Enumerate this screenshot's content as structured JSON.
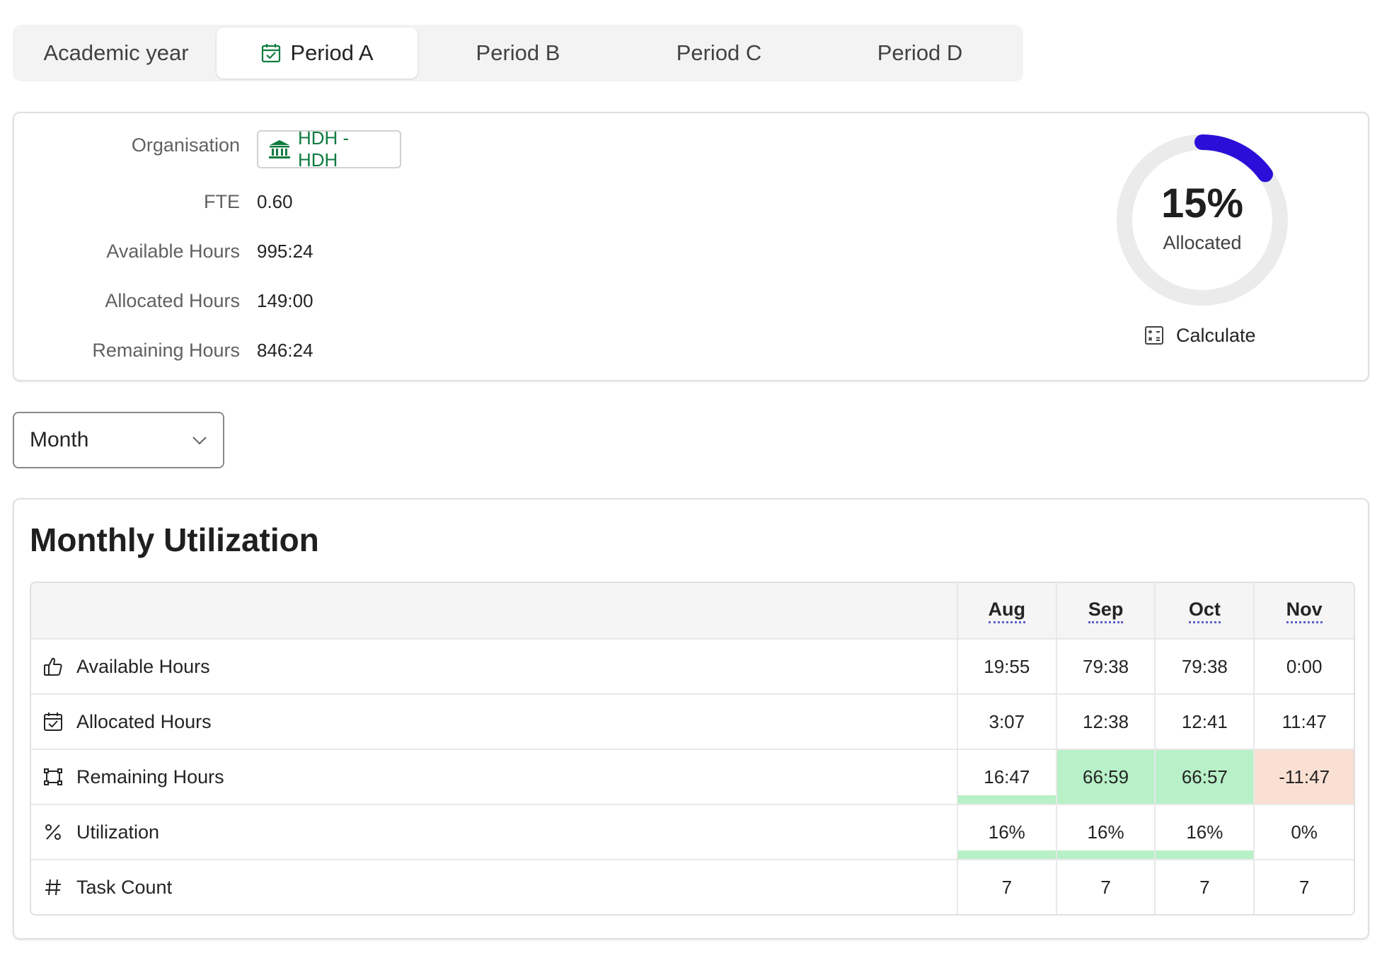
{
  "tabs": [
    {
      "label": "Academic year",
      "selected": false
    },
    {
      "label": "Period A",
      "selected": true,
      "icon": "calendar-check-icon"
    },
    {
      "label": "Period B",
      "selected": false
    },
    {
      "label": "Period C",
      "selected": false
    },
    {
      "label": "Period D",
      "selected": false
    }
  ],
  "info": {
    "organisation_label": "Organisation",
    "organisation_value": "HDH - HDH",
    "organisation_icon": "building-bank-icon",
    "fte_label": "FTE",
    "fte_value": "0.60",
    "available_label": "Available Hours",
    "available_value": "995:24",
    "allocated_label": "Allocated Hours",
    "allocated_value": "149:00",
    "remaining_label": "Remaining Hours",
    "remaining_value": "846:24"
  },
  "donut": {
    "percent_text": "15%",
    "percent": 15,
    "label": "Allocated",
    "progress_color": "#2b0fd8",
    "track_color": "#ebebeb"
  },
  "calculate": {
    "label": "Calculate",
    "icon": "calculator-icon"
  },
  "granularity": {
    "selected": "Month",
    "icon": "chevron-down-icon"
  },
  "utilization": {
    "title": "Monthly Utilization",
    "months": [
      "Aug",
      "Sep",
      "Oct",
      "Nov"
    ],
    "rows": [
      {
        "label": "Available Hours",
        "icon": "thumbs-up-icon",
        "values": [
          "19:55",
          "79:38",
          "79:38",
          "0:00"
        ]
      },
      {
        "label": "Allocated Hours",
        "icon": "calendar-check-icon",
        "values": [
          "3:07",
          "12:38",
          "12:41",
          "11:47"
        ]
      },
      {
        "label": "Remaining Hours",
        "icon": "resize-frame-icon",
        "values": [
          "16:47",
          "66:59",
          "66:57",
          "-11:47"
        ]
      },
      {
        "label": "Utilization",
        "icon": "percent-icon",
        "values": [
          "16%",
          "16%",
          "16%",
          "0%"
        ]
      },
      {
        "label": "Task Count",
        "icon": "number-symbol-icon",
        "values": [
          "7",
          "7",
          "7",
          "7"
        ]
      }
    ],
    "colors": {
      "positive": "#b8f0c8",
      "negative": "#fadfd3"
    }
  }
}
